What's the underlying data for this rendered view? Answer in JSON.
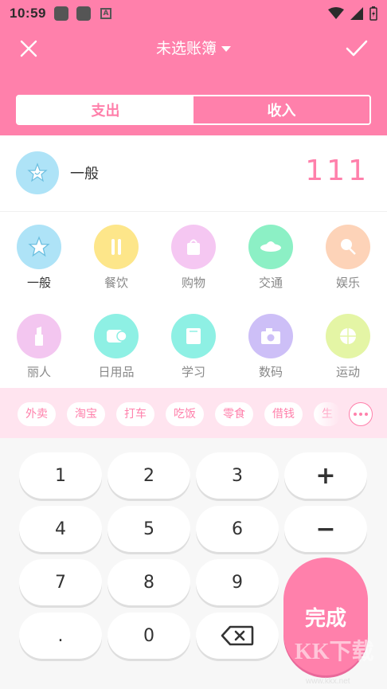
{
  "status_bar": {
    "time": "10:59"
  },
  "header": {
    "title": "未选账簿"
  },
  "segment": {
    "tabs": [
      "支出",
      "收入"
    ]
  },
  "selected": {
    "label": "一般",
    "amount": "111"
  },
  "categories": [
    {
      "name": "一般",
      "color": "#aee3f7"
    },
    {
      "name": "餐饮",
      "color": "#fde68a"
    },
    {
      "name": "购物",
      "color": "#f5c7f2"
    },
    {
      "name": "交通",
      "color": "#8cf0c5"
    },
    {
      "name": "娱乐",
      "color": "#fdd3b8"
    },
    {
      "name": "丽人",
      "color": "#f3c6f0"
    },
    {
      "name": "日用品",
      "color": "#8ef0e4"
    },
    {
      "name": "学习",
      "color": "#8ef0e4"
    },
    {
      "name": "数码",
      "color": "#cdbff7"
    },
    {
      "name": "运动",
      "color": "#e4f5a5"
    }
  ],
  "tags": [
    "外卖",
    "淘宝",
    "打车",
    "吃饭",
    "零食",
    "借钱",
    "生"
  ],
  "keypad": {
    "keys": [
      "1",
      "2",
      "3",
      "+",
      "4",
      "5",
      "6",
      "−",
      "7",
      "8",
      "9",
      ".",
      "0"
    ],
    "done": "完成"
  },
  "watermark": {
    "brand": "KK下载",
    "url": "www.kkx.net"
  },
  "colors": {
    "accent": "#ff80ab",
    "tag_bg": "#ffe4ef",
    "keypad_bg": "#f7f7f7"
  }
}
